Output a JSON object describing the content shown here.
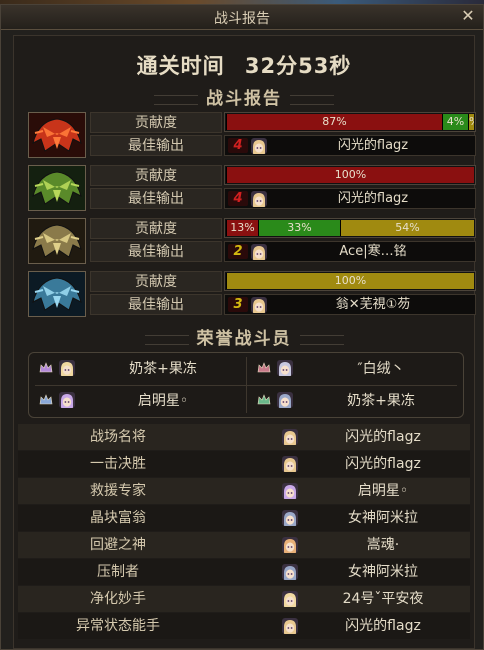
{
  "window": {
    "title": "战斗报告"
  },
  "clear_time": {
    "label": "通关时间",
    "value": "32分53秒"
  },
  "battle_report": {
    "heading": "战斗报告"
  },
  "contribution_label": "贡献度",
  "best_output_label": "最佳输出",
  "teams": [
    {
      "emblem": "red-crest-icon",
      "contribution": [
        {
          "label": "87%",
          "value": 87,
          "color": "#8a1010"
        },
        {
          "label": "4%",
          "value": 4,
          "color": "#2a8a1a"
        },
        {
          "label": "%",
          "value": 0,
          "color": "#a08a10"
        }
      ],
      "best_output": {
        "rank": "4",
        "rank_color": "#d02020",
        "name": "闪光的flagz"
      }
    },
    {
      "emblem": "green-crest-icon",
      "contribution": [
        {
          "label": "100%",
          "value": 100,
          "color": "#8a1010"
        }
      ],
      "best_output": {
        "rank": "4",
        "rank_color": "#d02020",
        "name": "闪光的flagz"
      }
    },
    {
      "emblem": "gold-crest-icon",
      "contribution": [
        {
          "label": "13%",
          "value": 13,
          "color": "#8a1010"
        },
        {
          "label": "33%",
          "value": 33,
          "color": "#2a8a1a"
        },
        {
          "label": "54%",
          "value": 54,
          "color": "#a08a10"
        }
      ],
      "best_output": {
        "rank": "2",
        "rank_color": "#d4b810",
        "name": "Ace|寒…铭"
      }
    },
    {
      "emblem": "blue-crest-icon",
      "contribution": [
        {
          "label": "100%",
          "value": 100,
          "color": "#a08a10"
        }
      ],
      "best_output": {
        "rank": "3",
        "rank_color": "#d4b810",
        "name": "翁✕芜視①芴"
      }
    }
  ],
  "honor": {
    "heading": "荣誉战斗员",
    "members": [
      {
        "name": "奶茶+果冻",
        "crown": "#b48ad8"
      },
      {
        "name": "″白绒丶",
        "crown": "#c87a8a"
      },
      {
        "name": "启明星◦",
        "crown": "#8aa8d8"
      },
      {
        "name": "奶茶+果冻",
        "crown": "#6ab88a"
      }
    ]
  },
  "awards": [
    {
      "title": "战场名将",
      "name": "闪光的flagz",
      "face": "#e8c890"
    },
    {
      "title": "一击决胜",
      "name": "闪光的flagz",
      "face": "#e8c890"
    },
    {
      "title": "救援专家",
      "name": "启明星◦",
      "face": "#c8a8e8"
    },
    {
      "title": "晶块富翁",
      "name": "女神阿米拉",
      "face": "#9aa8c8"
    },
    {
      "title": "回避之神",
      "name": "嵩魂·",
      "face": "#e8b078"
    },
    {
      "title": "压制者",
      "name": "女神阿米拉",
      "face": "#9aa8c8"
    },
    {
      "title": "净化妙手",
      "name": "24号ˇ平安夜",
      "face": "#f0d8a0"
    },
    {
      "title": "异常状态能手",
      "name": "闪光的flagz",
      "face": "#e8c890"
    }
  ]
}
